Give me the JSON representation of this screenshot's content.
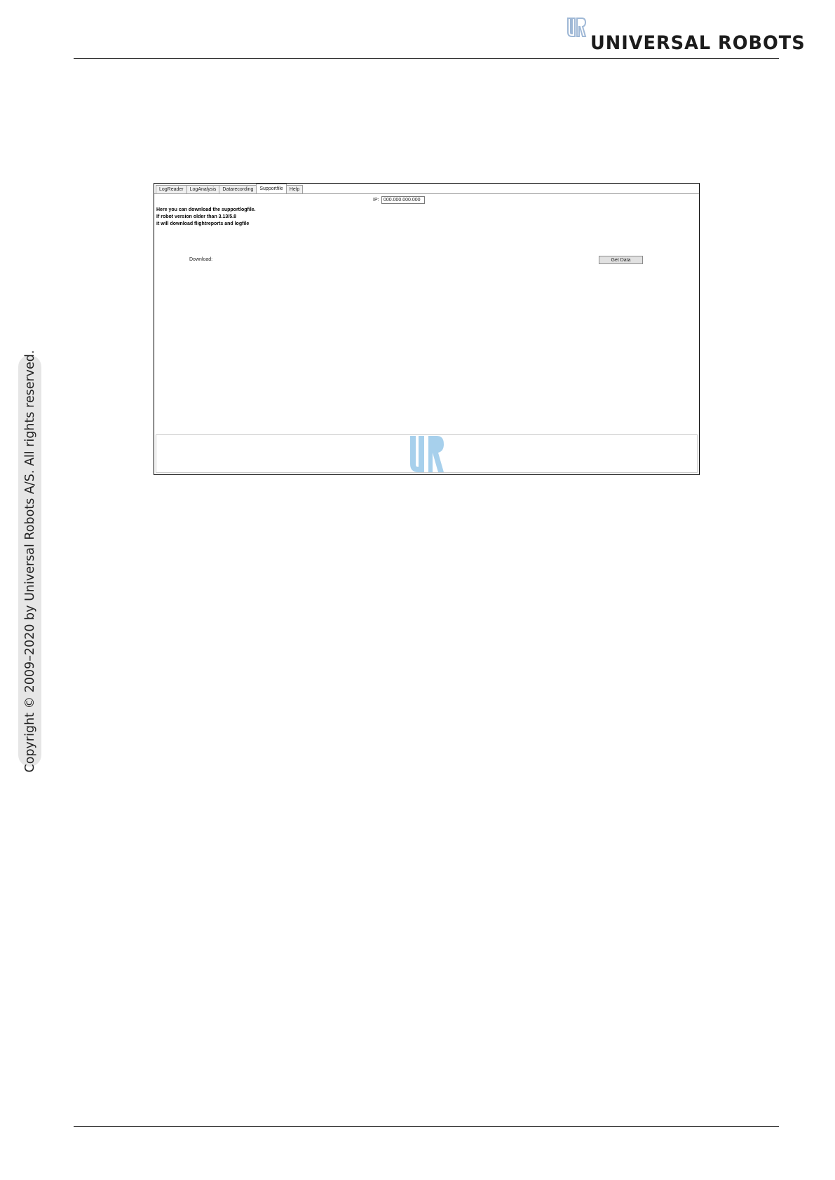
{
  "header": {
    "brand": "UNIVERSAL ROBOTS",
    "logo_icon": "ur-logo-icon",
    "accent_color": "#9fb8d6"
  },
  "sidebar": {
    "copyright": "Copyright © 2009–2020 by Universal Robots A/S. All rights reserved."
  },
  "app": {
    "tabs": [
      {
        "label": "LogReader"
      },
      {
        "label": "LogAnalysis"
      },
      {
        "label": "Datarecording"
      },
      {
        "label": "Supportfile"
      },
      {
        "label": "Help"
      }
    ],
    "active_tab": "Supportfile",
    "ip": {
      "label": "IP:",
      "value": "000.000.000.000"
    },
    "info_lines": [
      "Here you can download the supportlogfile.",
      "If robot version older than 3.13/5.8",
      "it will download flightreports and logfile"
    ],
    "download_label": "Download:",
    "get_data_label": "Get Data",
    "footer_logo_icon": "ur-logo-icon",
    "footer_logo_color": "#a7d0ec"
  }
}
